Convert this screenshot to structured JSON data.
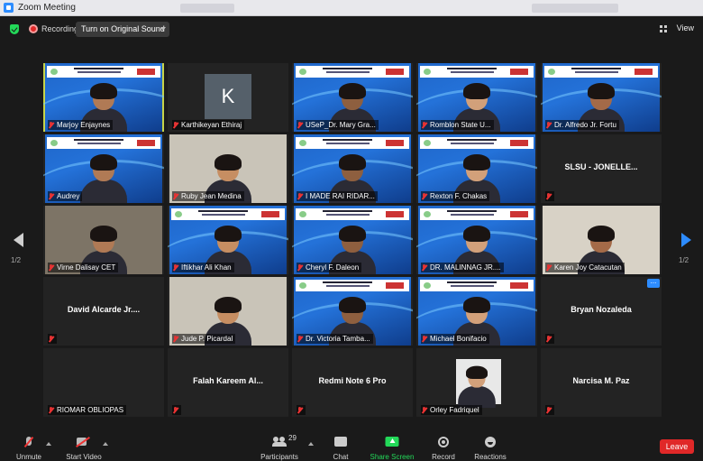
{
  "window": {
    "title": "Zoom Meeting"
  },
  "topbar": {
    "recording_label": "Recording",
    "original_sound_label": "Turn on Original Sound",
    "view_label": "View"
  },
  "gallery": {
    "page_left": "1/2",
    "page_right": "1/2",
    "tiles": [
      {
        "name": "Marjoy Enjaynes",
        "style": "slide"
      },
      {
        "name": "Karthikeyan Ethiraj",
        "style": "avatar",
        "initial": "K"
      },
      {
        "name": "USeP_Dr. Mary Gra...",
        "style": "slide"
      },
      {
        "name": "Romblon State U...",
        "style": "slide"
      },
      {
        "name": "Dr. Alfredo Jr. Fortu",
        "style": "slide"
      },
      {
        "name": "Audrey",
        "style": "slide"
      },
      {
        "name": "Ruby Jean Medina",
        "style": "room"
      },
      {
        "name": "I MADE RAI RIDAR...",
        "style": "slide"
      },
      {
        "name": "Rexton F. Chakas",
        "style": "slide"
      },
      {
        "name": "",
        "style": "text",
        "big_name": "SLSU - JONELLE..."
      },
      {
        "name": "Virne Dalisay CET",
        "style": "room"
      },
      {
        "name": "Iftikhar Ali Khan",
        "style": "slide"
      },
      {
        "name": "Cheryl F. Daleon",
        "style": "slide"
      },
      {
        "name": "DR. MALINNAG JR....",
        "style": "slide"
      },
      {
        "name": "Karen Joy Catacutan",
        "style": "room"
      },
      {
        "name": "",
        "style": "text",
        "big_name": "David Alcarde Jr...."
      },
      {
        "name": "Jude P. Picardal",
        "style": "room"
      },
      {
        "name": "Dr. Victoria Tamba...",
        "style": "slide"
      },
      {
        "name": "Michael Bonifacio",
        "style": "slide"
      },
      {
        "name": "",
        "style": "text",
        "big_name": "Bryan Nozaleda"
      },
      {
        "name": "RIOMAR OBLIOPAS",
        "style": "blank"
      },
      {
        "name": "",
        "style": "text",
        "big_name": "Falah Kareem Al..."
      },
      {
        "name": "",
        "style": "text",
        "big_name": "Redmi Note 6 Pro"
      },
      {
        "name": "Orley Fadriquel",
        "style": "photo"
      },
      {
        "name": "",
        "style": "text",
        "big_name": "Narcisa M. Paz"
      }
    ]
  },
  "toolbar": {
    "unmute": "Unmute",
    "start_video": "Start Video",
    "participants": "Participants",
    "participant_count": "29",
    "chat": "Chat",
    "share_screen": "Share Screen",
    "record": "Record",
    "reactions": "Reactions",
    "leave": "Leave"
  },
  "colors": {
    "accent": "#2d8cff",
    "share": "#23d959",
    "leave": "#e02828",
    "active_speaker": "#c6d44a"
  }
}
